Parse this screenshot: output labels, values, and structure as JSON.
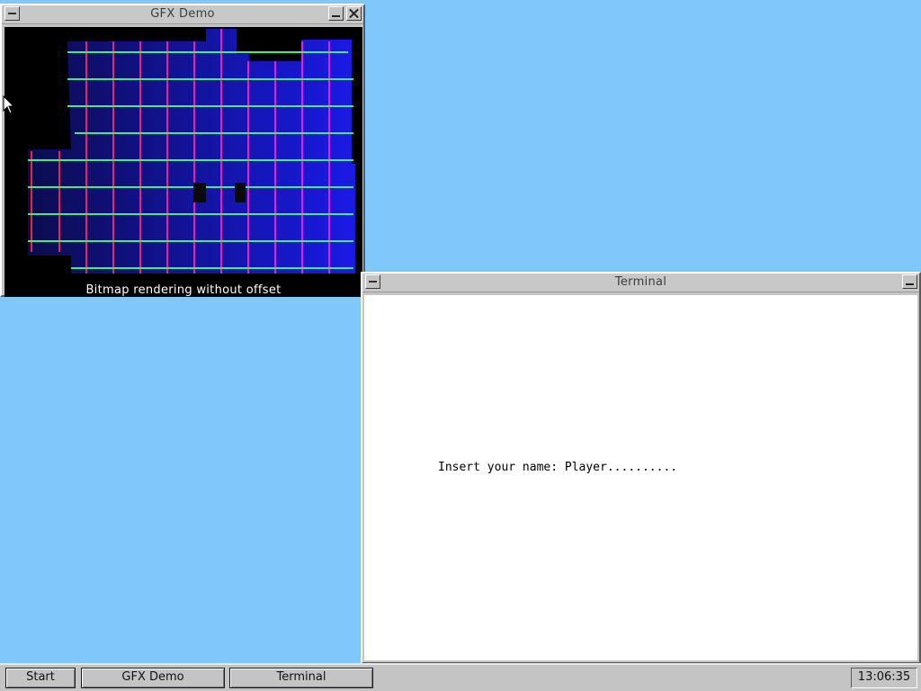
{
  "desktop": {
    "background": "#80c8fc"
  },
  "gfx_window": {
    "title": "GFX Demo",
    "caption": "Bitmap rendering without offset"
  },
  "terminal_window": {
    "title": "Terminal",
    "text": "Insert your name: Player.........."
  },
  "taskbar": {
    "start_label": "Start",
    "tasks": [
      "GFX Demo",
      "Terminal"
    ],
    "clock": "13:06:35"
  }
}
